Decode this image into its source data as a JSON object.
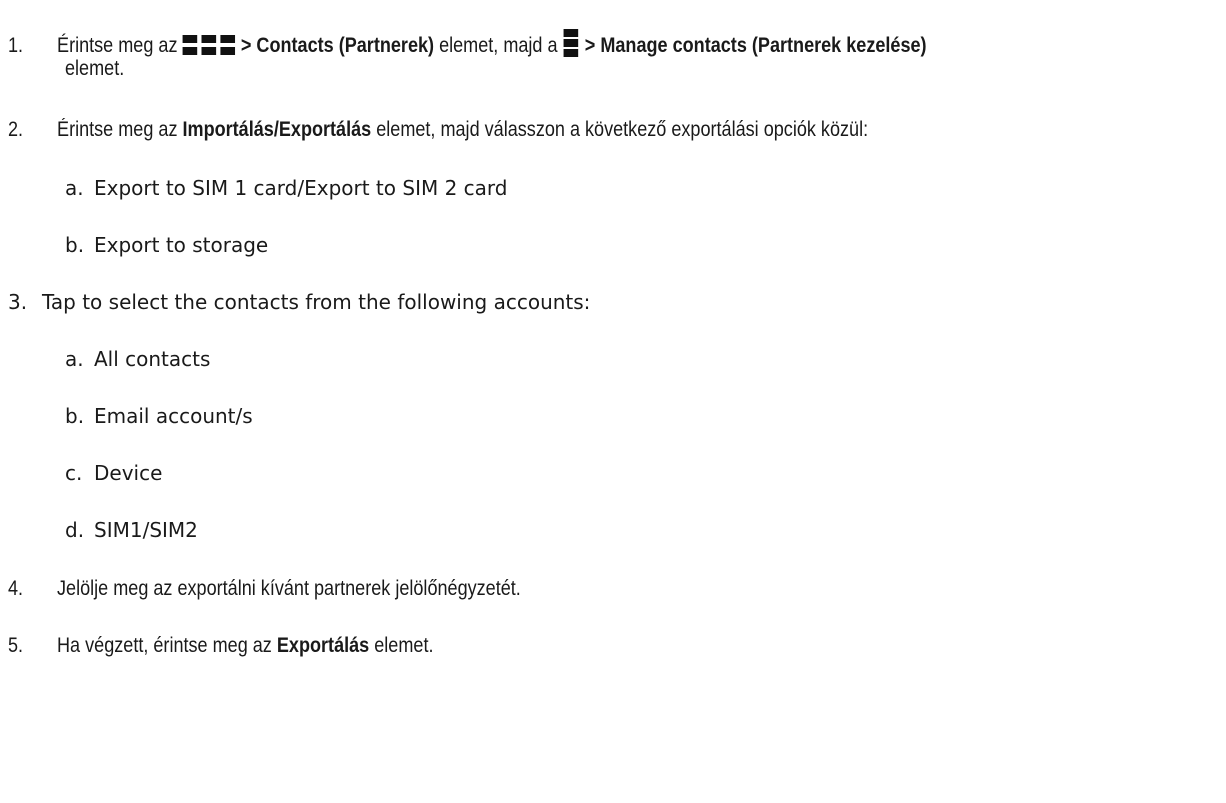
{
  "steps": [
    {
      "num": "1.",
      "pre": "Érintse meg az",
      "b1": "> Contacts (Partnerek)",
      "mid": "elemet, majd a",
      "b2": "> Manage contacts (Partnerek kezelése)",
      "cont": "elemet."
    },
    {
      "num": "2.",
      "pre": "Érintse meg az",
      "b1": "Importálás/Exportálás",
      "post": "elemet, majd válasszon a következő exportálási opciók közül:",
      "subitems": [
        {
          "letter": "a.",
          "text": "Export to SIM 1 card/Export to SIM 2 card"
        },
        {
          "letter": "b.",
          "text": "Export to storage"
        }
      ]
    },
    {
      "num": "3.",
      "text": "Tap to select the contacts from the following accounts:",
      "subitems": [
        {
          "letter": "a.",
          "text": "All contacts"
        },
        {
          "letter": "b.",
          "text": "Email account/s"
        },
        {
          "letter": "c.",
          "text": "Device"
        },
        {
          "letter": "d.",
          "text": "SIM1/SIM2"
        }
      ]
    },
    {
      "num": "4.",
      "text": "Jelölje meg az exportálni kívánt partnerek jelölőnégyzetét."
    },
    {
      "num": "5.",
      "pre": "Ha végzett, érintse meg az",
      "b1": "Exportálás",
      "post": "elemet."
    }
  ],
  "icons": {
    "apps": "apps-grid-icon",
    "menu": "overflow-menu-icon"
  }
}
